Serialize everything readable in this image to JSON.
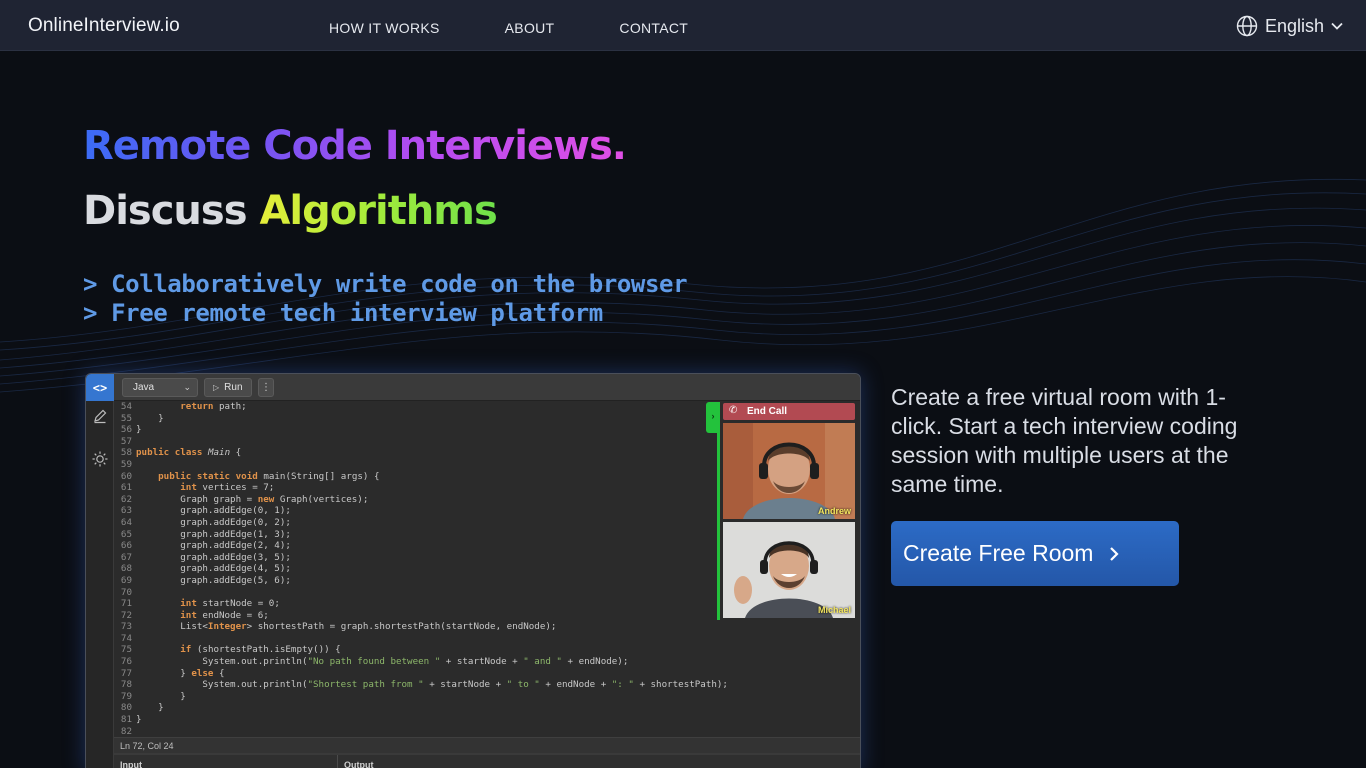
{
  "nav": {
    "brand": "OnlineInterview.io",
    "links": [
      "HOW IT WORKS",
      "ABOUT",
      "CONTACT"
    ],
    "language": "English"
  },
  "hero": {
    "headline": "Remote Code Interviews.",
    "subhead_prefix": "Discuss",
    "subhead_accent": "Algorithms",
    "tagline_1": "> Collaboratively write code on the browser",
    "tagline_2": "> Free remote tech interview platform"
  },
  "editor": {
    "rail_label": "<>",
    "language": "Java",
    "run_label": "Run",
    "more_label": "⋮",
    "status": "Ln 72, Col 24",
    "input_label": "Input",
    "output_label": "Output",
    "end_call_label": "End Call",
    "participants": [
      "Andrew",
      "Michael"
    ],
    "code_lines": [
      {
        "n": "54",
        "t": "        return path;"
      },
      {
        "n": "55",
        "t": "    }"
      },
      {
        "n": "56",
        "t": "}"
      },
      {
        "n": "57",
        "t": ""
      },
      {
        "n": "58",
        "t": "public class Main {"
      },
      {
        "n": "59",
        "t": ""
      },
      {
        "n": "60",
        "t": "    public static void main(String[] args) {"
      },
      {
        "n": "61",
        "t": "        int vertices = 7;"
      },
      {
        "n": "62",
        "t": "        Graph graph = new Graph(vertices);"
      },
      {
        "n": "63",
        "t": "        graph.addEdge(0, 1);"
      },
      {
        "n": "64",
        "t": "        graph.addEdge(0, 2);"
      },
      {
        "n": "65",
        "t": "        graph.addEdge(1, 3);"
      },
      {
        "n": "66",
        "t": "        graph.addEdge(2, 4);"
      },
      {
        "n": "67",
        "t": "        graph.addEdge(3, 5);"
      },
      {
        "n": "68",
        "t": "        graph.addEdge(4, 5);"
      },
      {
        "n": "69",
        "t": "        graph.addEdge(5, 6);"
      },
      {
        "n": "70",
        "t": ""
      },
      {
        "n": "71",
        "t": "        int startNode = 0;"
      },
      {
        "n": "72",
        "t": "        int endNode = 6;"
      },
      {
        "n": "73",
        "t": "        List<Integer> shortestPath = graph.shortestPath(startNode, endNode);"
      },
      {
        "n": "74",
        "t": ""
      },
      {
        "n": "75",
        "t": "        if (shortestPath.isEmpty()) {"
      },
      {
        "n": "76",
        "t": "            System.out.println(\"No path found between \" + startNode + \" and \" + endNode);"
      },
      {
        "n": "77",
        "t": "        } else {"
      },
      {
        "n": "78",
        "t": "            System.out.println(\"Shortest path from \" + startNode + \" to \" + endNode + \": \" + shortestPath);"
      },
      {
        "n": "79",
        "t": "        }"
      },
      {
        "n": "80",
        "t": "    }"
      },
      {
        "n": "81",
        "t": "}"
      },
      {
        "n": "82",
        "t": ""
      }
    ]
  },
  "pitch": {
    "text": "Create a free virtual room with 1-click. Start a tech interview coding session with multiple users at the same time.",
    "cta_label": "Create Free Room"
  },
  "colors": {
    "background": "#0b0e14",
    "nav_bg": "#1f2433",
    "cta": "#2c6bc6",
    "tagline": "#5f9ae6",
    "video_accent": "#23c23c",
    "end_call": "#b24a52"
  },
  "icons": {
    "language": "globe-icon",
    "language_toggle": "chevron-down-icon",
    "rail_code": "code-icon",
    "rail_draw": "pencil-icon",
    "rail_theme": "sun-icon",
    "run": "play-icon",
    "end_call": "phone-slash-icon",
    "cta": "chevron-right-icon"
  }
}
